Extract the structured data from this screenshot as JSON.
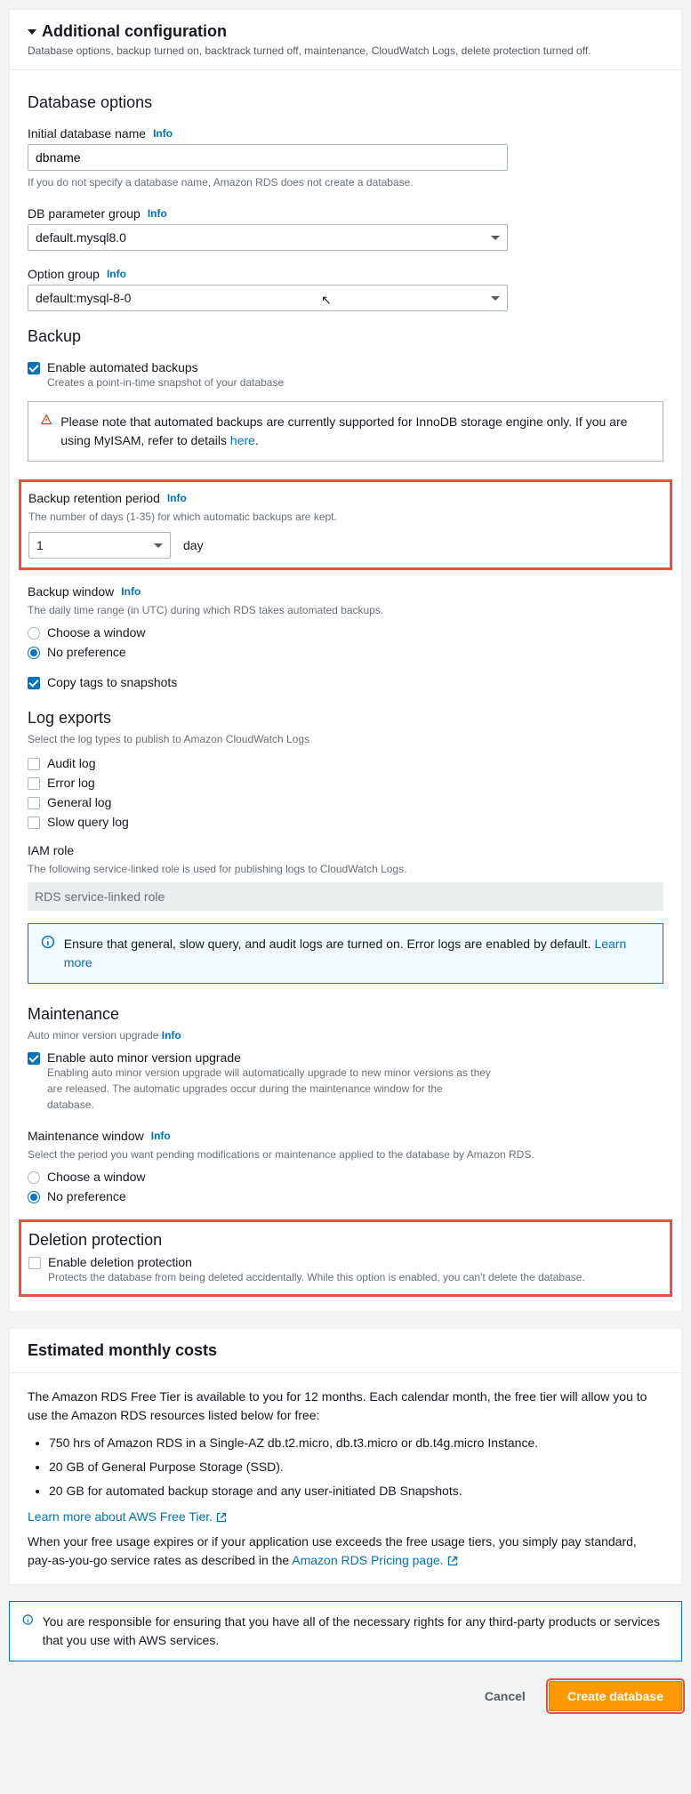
{
  "header": {
    "title": "Additional configuration",
    "sub": "Database options, backup turned on, backtrack turned off, maintenance, CloudWatch Logs, delete protection turned off."
  },
  "info": "Info",
  "dbOptions": {
    "title": "Database options",
    "initial": {
      "label": "Initial database name",
      "value": "dbname",
      "hint": "If you do not specify a database name, Amazon RDS does not create a database."
    },
    "paramGroup": {
      "label": "DB parameter group",
      "value": "default.mysql8.0"
    },
    "optionGroup": {
      "label": "Option group",
      "value": "default:mysql-8-0"
    }
  },
  "backup": {
    "title": "Backup",
    "enable": {
      "label": "Enable automated backups",
      "hint": "Creates a point-in-time snapshot of your database"
    },
    "warn": {
      "text": "Please note that automated backups are currently supported for InnoDB storage engine only. If you are using MyISAM, refer to details ",
      "link": "here"
    },
    "retention": {
      "label": "Backup retention period",
      "hint": "The number of days (1-35) for which automatic backups are kept.",
      "value": "1",
      "unit": "day"
    },
    "window": {
      "label": "Backup window",
      "hint": "The daily time range (in UTC) during which RDS takes automated backups.",
      "choose": "Choose a window",
      "nopref": "No preference"
    },
    "copyTags": "Copy tags to snapshots"
  },
  "logExports": {
    "title": "Log exports",
    "hint": "Select the log types to publish to Amazon CloudWatch Logs",
    "audit": "Audit log",
    "error": "Error log",
    "general": "General log",
    "slow": "Slow query log",
    "iamLabel": "IAM role",
    "iamHint": "The following service-linked role is used for publishing logs to CloudWatch Logs.",
    "iamValue": "RDS service-linked role",
    "infoMsg": "Ensure that general, slow query, and audit logs are turned on. Error logs are enabled by default. ",
    "learnMore": "Learn more"
  },
  "maintenance": {
    "title": "Maintenance",
    "sub": "Auto minor version upgrade",
    "enable": {
      "label": "Enable auto minor version upgrade",
      "hint": "Enabling auto minor version upgrade will automatically upgrade to new minor versions as they are released. The automatic upgrades occur during the maintenance window for the database."
    },
    "window": {
      "label": "Maintenance window",
      "hint": "Select the period you want pending modifications or maintenance applied to the database by Amazon RDS.",
      "choose": "Choose a window",
      "nopref": "No preference"
    }
  },
  "deletion": {
    "title": "Deletion protection",
    "label": "Enable deletion protection",
    "hint": "Protects the database from being deleted accidentally. While this option is enabled, you can't delete the database."
  },
  "costs": {
    "title": "Estimated monthly costs",
    "intro": "The Amazon RDS Free Tier is available to you for 12 months. Each calendar month, the free tier will allow you to use the Amazon RDS resources listed below for free:",
    "b1": "750 hrs of Amazon RDS in a Single-AZ db.t2.micro, db.t3.micro or db.t4g.micro Instance.",
    "b2": "20 GB of General Purpose Storage (SSD).",
    "b3": "20 GB for automated backup storage and any user-initiated DB Snapshots.",
    "learnFree": "Learn more about AWS Free Tier.",
    "outro1": "When your free usage expires or if your application use exceeds the free usage tiers, you simply pay standard, pay-as-you-go service rates as described in the ",
    "pricingLink": "Amazon RDS Pricing page."
  },
  "responsibility": "You are responsible for ensuring that you have all of the necessary rights for any third-party products or services that you use with AWS services.",
  "footer": {
    "cancel": "Cancel",
    "create": "Create database"
  }
}
